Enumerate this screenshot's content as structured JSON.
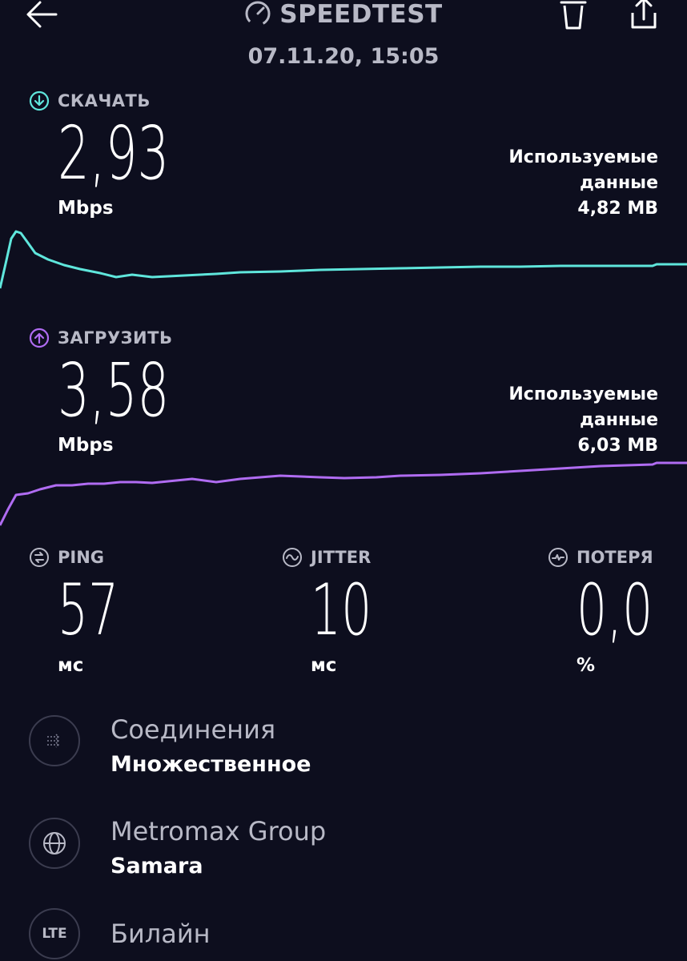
{
  "header": {
    "title": "SPEEDTEST",
    "datetime": "07.11.20, 15:05"
  },
  "download": {
    "label": "СКАЧАТЬ",
    "value": "2,93",
    "unit": "Mbps",
    "used_line1": "Используемые",
    "used_line2": "данные",
    "used_value": "4,82 MB",
    "color": "#5fe6dc"
  },
  "upload": {
    "label": "ЗАГРУЗИТЬ",
    "value": "3,58",
    "unit": "Mbps",
    "used_line1": "Используемые",
    "used_line2": "данные",
    "used_value": "6,03 MB",
    "color": "#b06cf2"
  },
  "stats": {
    "ping": {
      "label": "PING",
      "value": "57",
      "unit": "мс"
    },
    "jitter": {
      "label": "JITTER",
      "value": "10",
      "unit": "мс"
    },
    "loss": {
      "label": "ПОТЕРЯ",
      "value": "0,0",
      "unit": "%"
    }
  },
  "info": {
    "connections": {
      "title": "Соединения",
      "value": "Множественное",
      "icon": "multi-arrows-icon"
    },
    "server": {
      "title": "Metromax Group",
      "value": "Samara",
      "icon": "globe-icon"
    },
    "provider": {
      "title": "Билайн",
      "icon_text": "LTE",
      "icon": "lte-icon"
    }
  },
  "colors": {
    "background": "#0d0e1e",
    "muted_text": "#b8b9c6",
    "download_accent": "#5fe6dc",
    "upload_accent": "#b06cf2"
  }
}
